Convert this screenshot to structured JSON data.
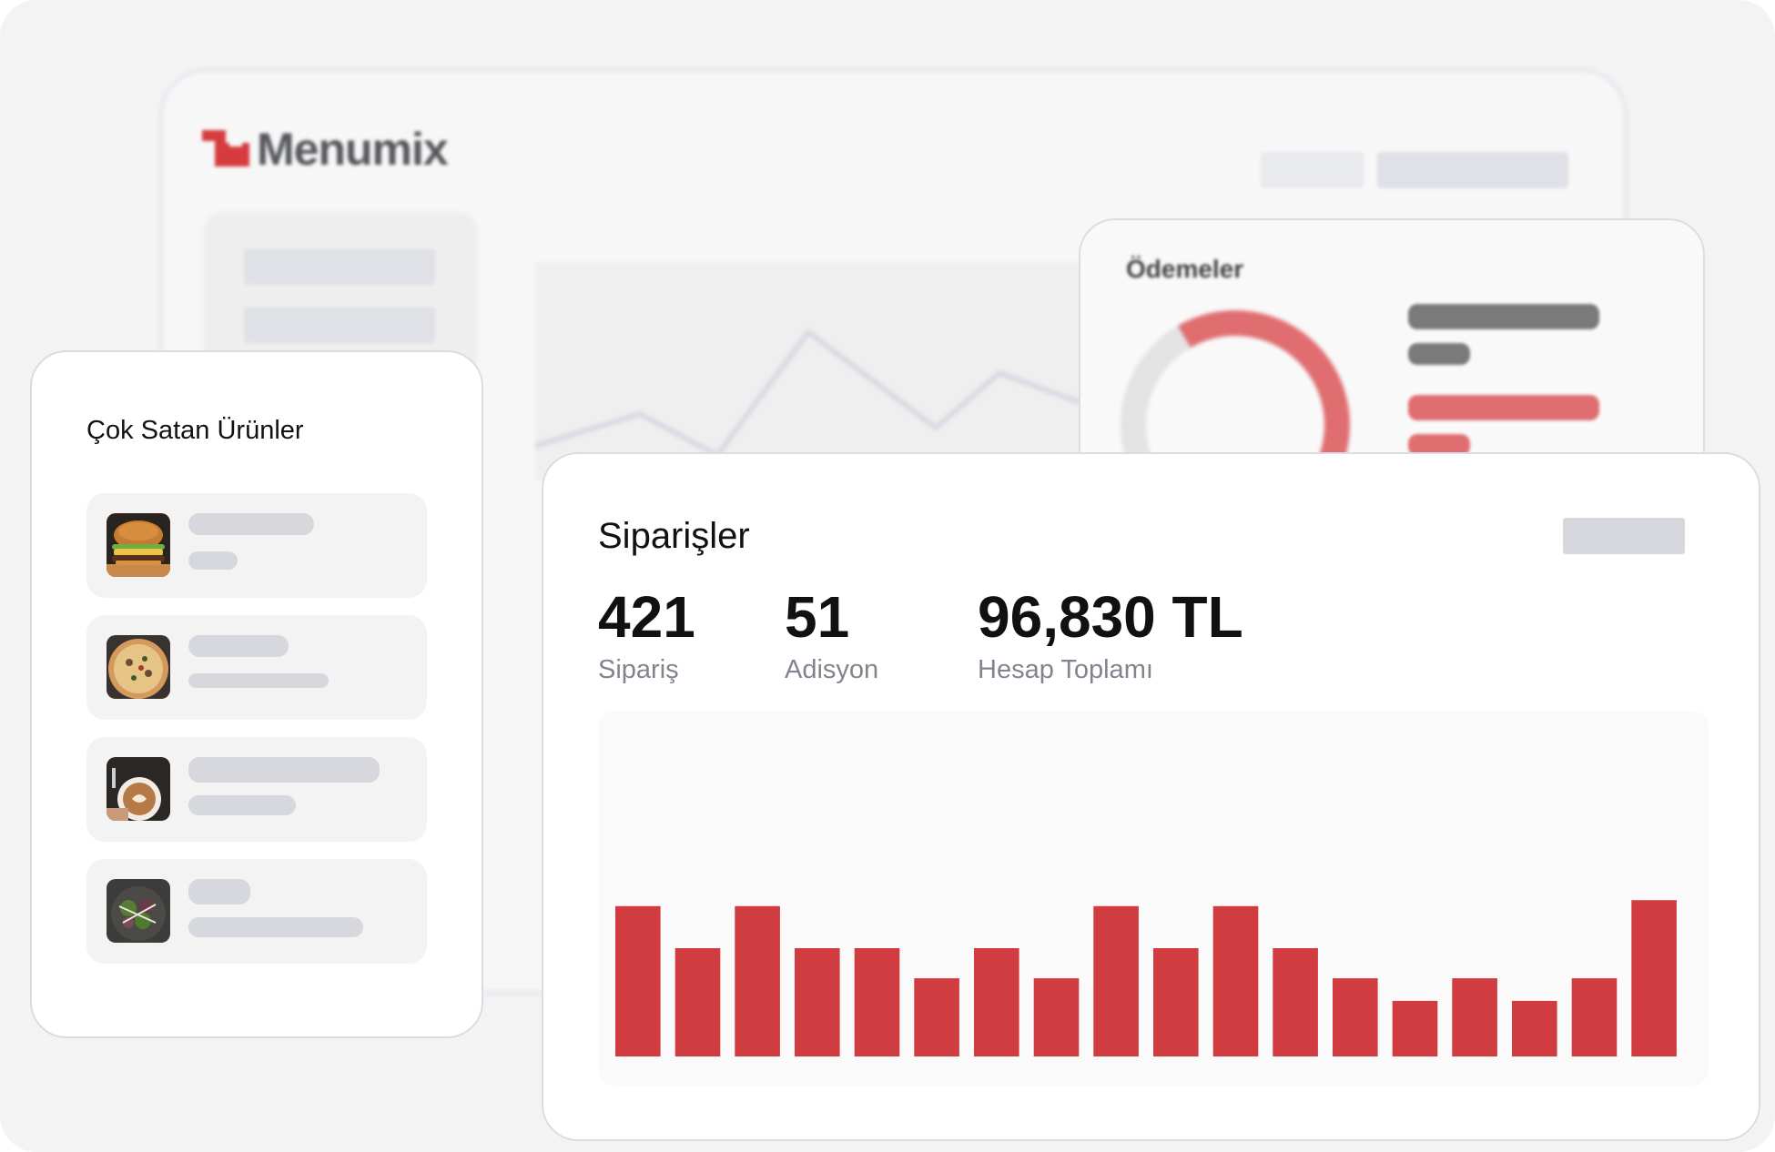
{
  "brand": {
    "name": "Menumix",
    "color": "#d63c3f"
  },
  "payments": {
    "title": "Ödemeler",
    "donut": {
      "accent": "#e06e71",
      "track": "#e3e3e3",
      "accent_fraction": 0.45
    }
  },
  "bestsellers": {
    "title": "Çok Satan Ürünler",
    "items": [
      {
        "icon": "burger-image"
      },
      {
        "icon": "pizza-image"
      },
      {
        "icon": "coffee-image"
      },
      {
        "icon": "salad-image"
      }
    ]
  },
  "orders": {
    "title": "Siparişler",
    "stats": [
      {
        "value": "421",
        "label": "Sipariş"
      },
      {
        "value": "51",
        "label": "Adisyon"
      },
      {
        "value": "96,830 TL",
        "label": "Hesap Toplamı"
      }
    ]
  },
  "chart_data": {
    "type": "bar",
    "bar_color": "#d03c3f",
    "values": [
      100,
      72,
      100,
      72,
      72,
      52,
      72,
      52,
      100,
      72,
      100,
      72,
      52,
      37,
      52,
      37,
      52,
      104
    ],
    "ylim": [
      0,
      230
    ]
  }
}
